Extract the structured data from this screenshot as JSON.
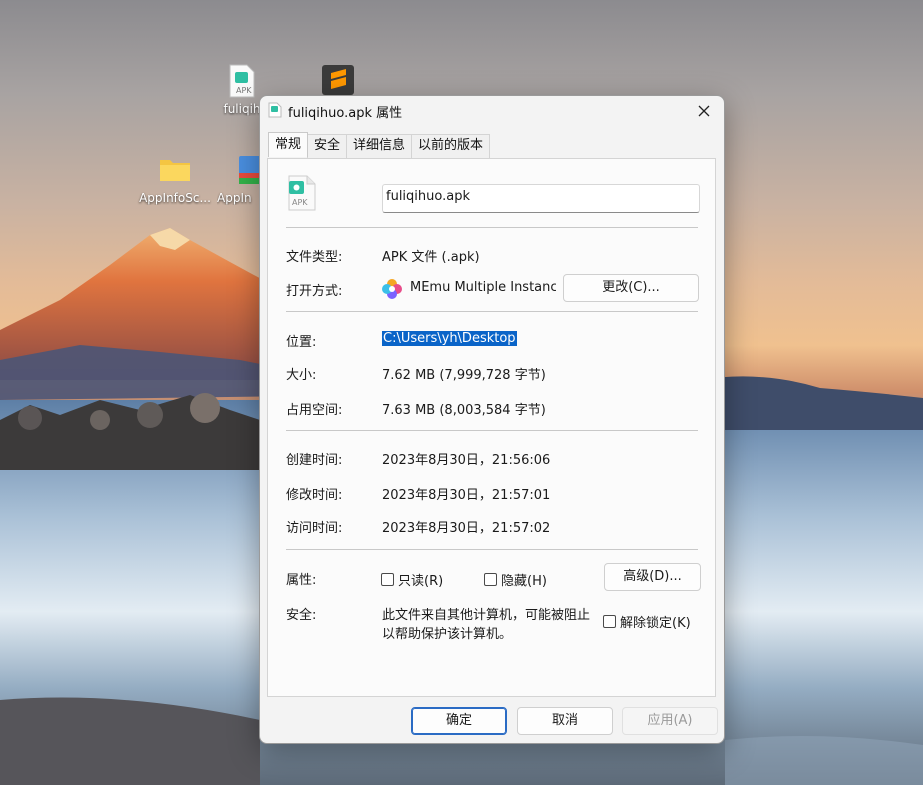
{
  "desktop": {
    "icons": [
      {
        "label": "fuliqih"
      },
      {
        "label": "AppInfoSc..."
      },
      {
        "label": "AppIn"
      }
    ]
  },
  "dialog": {
    "title": "fuliqihuo.apk 属性",
    "tabs": [
      {
        "label": "常规"
      },
      {
        "label": "安全"
      },
      {
        "label": "详细信息"
      },
      {
        "label": "以前的版本"
      }
    ],
    "file_icon_text": "APK",
    "file_name": "fuliqihuo.apk",
    "type_label": "文件类型:",
    "type_value": "APK 文件 (.apk)",
    "open_label": "打开方式:",
    "open_value": "MEmu Multiple Instanc",
    "change_button": "更改(C)...",
    "location_label": "位置:",
    "location_value": "C:\\Users\\yh\\Desktop",
    "size_label": "大小:",
    "size_value": "7.62 MB (7,999,728 字节)",
    "disk_label": "占用空间:",
    "disk_value": "7.63 MB (8,003,584 字节)",
    "created_label": "创建时间:",
    "created_value": "2023年8月30日，21:56:06",
    "modified_label": "修改时间:",
    "modified_value": "2023年8月30日，21:57:01",
    "accessed_label": "访问时间:",
    "accessed_value": "2023年8月30日，21:57:02",
    "attr_label": "属性:",
    "readonly_label": "只读(R)",
    "hidden_label": "隐藏(H)",
    "advanced_button": "高级(D)...",
    "security_label": "安全:",
    "security_line1": "此文件来自其他计算机，可能被阻止",
    "security_line2": "以帮助保护该计算机。",
    "unblock_label": "解除锁定(K)",
    "ok_button": "确定",
    "cancel_button": "取消",
    "apply_button": "应用(A)"
  }
}
